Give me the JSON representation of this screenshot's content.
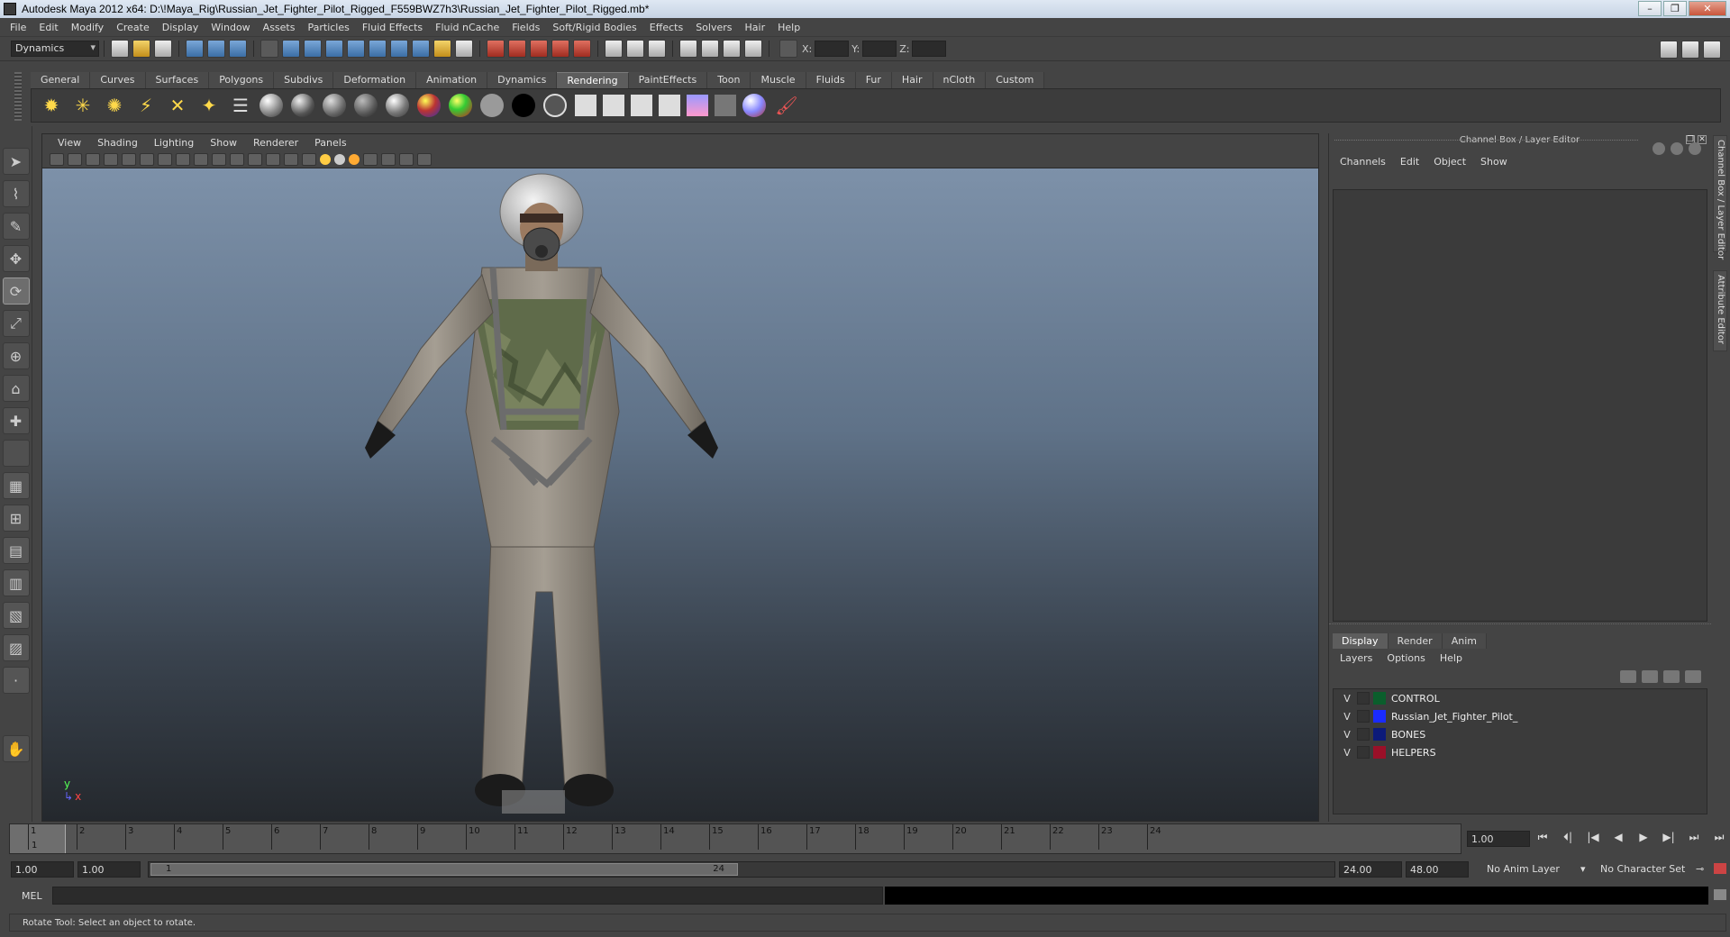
{
  "window": {
    "title": "Autodesk Maya 2012 x64: D:\\!Maya_Rig\\Russian_Jet_Fighter_Pilot_Rigged_F559BWZ7h3\\Russian_Jet_Fighter_Pilot_Rigged.mb*",
    "buttons": [
      "–",
      "❐",
      "✕"
    ]
  },
  "menubar": [
    "File",
    "Edit",
    "Modify",
    "Create",
    "Display",
    "Window",
    "Assets",
    "Particles",
    "Fluid Effects",
    "Fluid nCache",
    "Fields",
    "Soft/Rigid Bodies",
    "Effects",
    "Solvers",
    "Hair",
    "Help"
  ],
  "statusline": {
    "menuset": "Dynamics",
    "x_label": "X:",
    "y_label": "Y:",
    "z_label": "Z:"
  },
  "shelf": {
    "tabs": [
      "General",
      "Curves",
      "Surfaces",
      "Polygons",
      "Subdivs",
      "Deformation",
      "Animation",
      "Dynamics",
      "Rendering",
      "PaintEffects",
      "Toon",
      "Muscle",
      "Fluids",
      "Fur",
      "Hair",
      "nCloth",
      "Custom"
    ],
    "active_tab": "Rendering"
  },
  "panel": {
    "menu": [
      "View",
      "Shading",
      "Lighting",
      "Show",
      "Renderer",
      "Panels"
    ]
  },
  "viewport": {
    "axis_y": "y",
    "axis_x": "x"
  },
  "channelbox": {
    "title": "Channel Box / Layer Editor",
    "menu": [
      "Channels",
      "Edit",
      "Object",
      "Show"
    ]
  },
  "sidetabs": [
    "Channel Box / Layer Editor",
    "Attribute Editor"
  ],
  "layer_editor": {
    "tabs": [
      "Display",
      "Render",
      "Anim"
    ],
    "active_tab": "Display",
    "menu": [
      "Layers",
      "Options",
      "Help"
    ],
    "layers": [
      {
        "v": "V",
        "name": "CONTROL",
        "color": "#0b5e2c"
      },
      {
        "v": "V",
        "name": "Russian_Jet_Fighter_Pilot_",
        "color": "#1a2bff"
      },
      {
        "v": "V",
        "name": "BONES",
        "color": "#0c1a7a"
      },
      {
        "v": "V",
        "name": "HELPERS",
        "color": "#9a1028"
      }
    ]
  },
  "timeslider": {
    "ticks": [
      "1",
      "2",
      "3",
      "4",
      "5",
      "6",
      "7",
      "8",
      "9",
      "10",
      "11",
      "12",
      "13",
      "14",
      "15",
      "16",
      "17",
      "18",
      "19",
      "20",
      "21",
      "22",
      "23",
      "24"
    ],
    "current_frame": "1",
    "frame_field": "1.00"
  },
  "playback": [
    "⏮",
    "⏴|",
    "|◀",
    "◀",
    "▶",
    "▶|",
    "⏭",
    "⏭"
  ],
  "range": {
    "start": "1.00",
    "playback_start": "1.00",
    "slider_start": "1",
    "slider_end": "24",
    "playback_end": "24.00",
    "end": "48.00",
    "anim_layer": "No Anim Layer",
    "character_set": "No Character Set"
  },
  "cmdline": {
    "label": "MEL"
  },
  "helpline": {
    "text": "Rotate Tool: Select an object to rotate."
  }
}
